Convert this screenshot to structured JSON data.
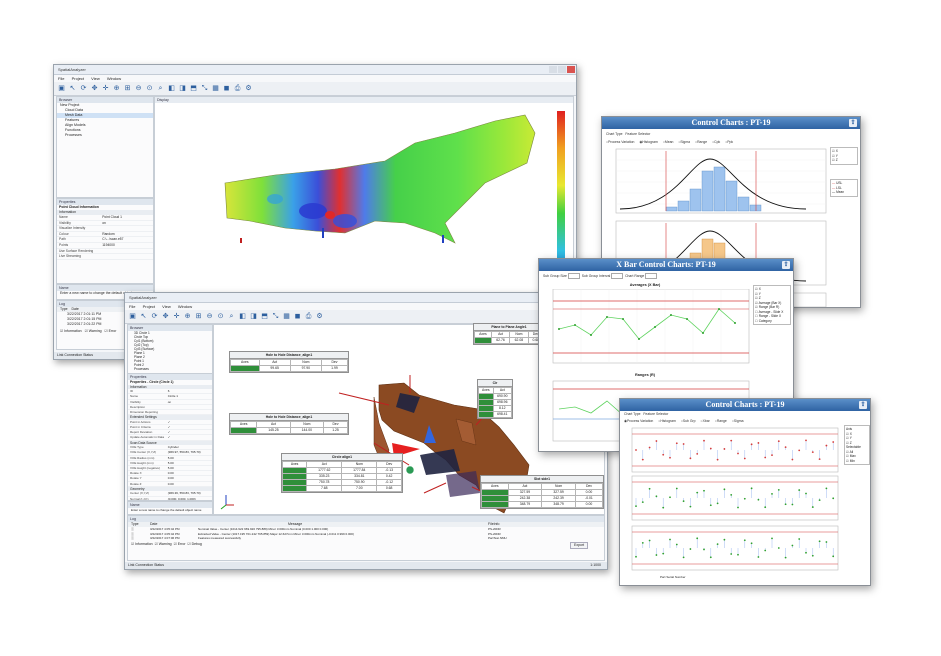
{
  "main_app": {
    "title": "SpatialAnalyzer",
    "menus": [
      "File",
      "Project",
      "View",
      "Window"
    ],
    "browser_title": "Browser",
    "tree": [
      "New Project",
      "Cloud Data",
      "Mesh Data",
      "Features",
      "Align Models",
      "Functions",
      "Processes"
    ],
    "display_title": "Display",
    "properties_title": "Properties",
    "properties_subtitle": "Point Cloud Information",
    "info_header": "Information",
    "properties": [
      {
        "k": "Name",
        "v": "Point Cloud 1"
      },
      {
        "k": "Visibility",
        "v": "on"
      },
      {
        "k": "Visualize Intensity",
        "v": ""
      },
      {
        "k": "Colour",
        "v": "Random"
      },
      {
        "k": "Path",
        "v": "C:\\...\\scan.e57"
      },
      {
        "k": "Points",
        "v": "1194000"
      },
      {
        "k": "Use Surface Rendering",
        "v": ""
      },
      {
        "k": "Live Streaming",
        "v": ""
      }
    ],
    "name_title": "Name",
    "name_hint": "Enter a new name to change the default object name",
    "log_title": "Log",
    "log_cols": [
      "Type",
      "Date"
    ],
    "log_rows": [
      "3/22/2017 2:01:11 PM",
      "3/22/2017 2:01:15 PM",
      "3/22/2017 2:01:22 PM"
    ],
    "log_filters": [
      "Information",
      "Warning",
      "Error"
    ],
    "status": "Link Connection Status"
  },
  "second_app": {
    "title": "SpatialAnalyzer",
    "menus": [
      "File",
      "Project",
      "View",
      "Window"
    ],
    "browser_title": "Browser",
    "tree": [
      "3D Circle 1",
      "Circle Top",
      "Cyl1 (Bottom)",
      "Cyl2 (Top)",
      "Cyl3 (Surface)",
      "Plane 1",
      "Plane 2",
      "Point 1",
      "Point 2",
      "Processes"
    ],
    "properties_title": "Properties",
    "properties_subtitle": "Properties - Circle (Circle 1)",
    "sections": [
      "Information",
      "Extended Settings",
      "Scan Data Source",
      "Geometry"
    ],
    "properties": [
      {
        "k": "ID",
        "v": "6"
      },
      {
        "k": "Name",
        "v": "Circle 1"
      },
      {
        "k": "Visibility",
        "v": "on"
      },
      {
        "k": "Description",
        "v": ""
      },
      {
        "k": "Dimension Reporting",
        "v": ""
      },
      {
        "k": "Point in Actions",
        "v": "✓"
      },
      {
        "k": "Point in Criteria",
        "v": "✓"
      },
      {
        "k": "Report Deviation",
        "v": "✓"
      },
      {
        "k": "Update Automatic in Data",
        "v": "✓"
      },
      {
        "k": "VOE Type",
        "v": "Cylinder"
      },
      {
        "k": "VOE Center (X,Y,Z)",
        "v": "(969.97, 550.83, 795.70)"
      },
      {
        "k": "VOE Radius (mm)",
        "v": "5.00"
      },
      {
        "k": "VOE Height (mm)",
        "v": "5.00"
      },
      {
        "k": "VOE Height (negative)",
        "v": "5.00"
      },
      {
        "k": "Rotate X",
        "v": "0.00"
      },
      {
        "k": "Rotate Y",
        "v": "0.00"
      },
      {
        "k": "Rotate Z",
        "v": "0.00"
      },
      {
        "k": "Center (X,Y,Z)",
        "v": "(969.36, 550.83, 795.70)"
      },
      {
        "k": "Normal (I,J,K)",
        "v": "(0.000, 0.000, 1.000)"
      }
    ],
    "name_title": "Name",
    "name_hint": "Enter a new name to change the default object name",
    "log_title": "Log",
    "log_cols": [
      "Type",
      "Date",
      "Message",
      "FileInfo"
    ],
    "log_rows": [
      {
        "date": "3/22/2017 4:05:42 PM",
        "msg": "Nominal Value - Center (1014.922 969.920 795.889) Minor 3.000mm Nominal (0.000 1.000 0.000)",
        "file": "PS-20DR"
      },
      {
        "date": "3/22/2017 4:05:42 PM",
        "msg": "Extracted Value - Center (1017.195 701.242 795.859) Major 12.627mm Minor 3.000mm Nominal (-0.011 0.999 0.000)",
        "file": "PS-20DR"
      },
      {
        "date": "3/22/2017 4:07:06 PM",
        "msg": "Features measured successfully",
        "file": "PartTest.NMU"
      }
    ],
    "log_filters": [
      "Information",
      "Warning",
      "Error",
      "Debug"
    ],
    "export_label": "Export",
    "clear_label": "Clear",
    "status": "Link Connection Status",
    "zoom": "1:1000"
  },
  "measure_cards": [
    {
      "title": "Plane to Plane Angle1",
      "cols": [
        "Axes",
        "Act",
        "Nom",
        "Dev"
      ],
      "rows": [
        [
          "",
          "62.76",
          "62.08",
          "0.68"
        ]
      ]
    },
    {
      "title": "Hole to Hole Distance_align1",
      "cols": [
        "Axes",
        "Act",
        "Nom",
        "Dev"
      ],
      "rows": [
        [
          "",
          "99.65",
          "97.90",
          "1.99"
        ]
      ]
    },
    {
      "title": "Hole to Hole Distance_align1",
      "cols": [
        "Axes",
        "Act",
        "Nom",
        "Dev"
      ],
      "rows": [
        [
          "",
          "145.25",
          "144.00",
          "1.25"
        ]
      ]
    },
    {
      "title": "Cir",
      "cols": [
        "Axes",
        "Act"
      ],
      "rows": [
        [
          "",
          "690.90"
        ],
        [
          "",
          "698.96"
        ],
        [
          "",
          "8.12"
        ],
        [
          "",
          "698.41"
        ]
      ]
    },
    {
      "title": "Circle align1",
      "cols": [
        "Axes",
        "Act",
        "Nom",
        "Dev"
      ],
      "rows": [
        [
          "",
          "1777.62",
          "1777.84",
          "-0.13"
        ],
        [
          "",
          "335.23",
          "334.81",
          "0.42"
        ],
        [
          "",
          "750.78",
          "750.90",
          "-0.12"
        ],
        [
          "",
          "7.68",
          "7.00",
          "0.68"
        ]
      ]
    },
    {
      "title": "Slot side1",
      "cols": [
        "Axes",
        "Act",
        "Nom",
        "Dev"
      ],
      "rows": [
        [
          "",
          "327.59",
          "327.59",
          "0.00"
        ],
        [
          "",
          "242.38",
          "242.39",
          "-0.01"
        ],
        [
          "",
          "348.79",
          "348.79",
          "0.00"
        ]
      ]
    }
  ],
  "chart1": {
    "title": "Control Charts : PT-19",
    "options": [
      "Chart Type",
      "Feature Selector",
      "Chart Category"
    ],
    "radios": [
      "Process Variation",
      "Histogram",
      "Mean",
      "Sigma",
      "Range",
      "Cpk",
      "Ppk"
    ],
    "side": [
      "X",
      "Y",
      "Z"
    ],
    "legend": [
      "USL",
      "LSL",
      "Mean"
    ]
  },
  "chart2": {
    "title": "X Bar Control Charts: PT-19",
    "options": [
      "Sub Group Size",
      "Sub Group Interval",
      "Chart Range"
    ],
    "sub1": "Averages (X Bar)",
    "sub2": "Ranges (R)",
    "side": [
      "X",
      "Y",
      "Z",
      "Average (Bar X)",
      "Range (Bar R)",
      "Average - Slide X",
      "Range - Slide X",
      "Category"
    ]
  },
  "chart3": {
    "title": "Control Charts : PT-19",
    "options": [
      "Chart Type",
      "Feature Selector"
    ],
    "radios": [
      "Process Variation",
      "Histogram",
      "Sub Grp",
      "Xbar",
      "Range",
      "Sigma"
    ],
    "side": [
      "Axis",
      "X",
      "Y",
      "Z",
      "Selectable",
      "All",
      "Max",
      "Min"
    ],
    "xlabel": "Part Serial Number"
  },
  "colors": {
    "chart_title": "#2f63a3",
    "mesh_brown": "#8b4a22",
    "ok_green": "#2f8f3a",
    "limit_red": "#d43c3c"
  }
}
